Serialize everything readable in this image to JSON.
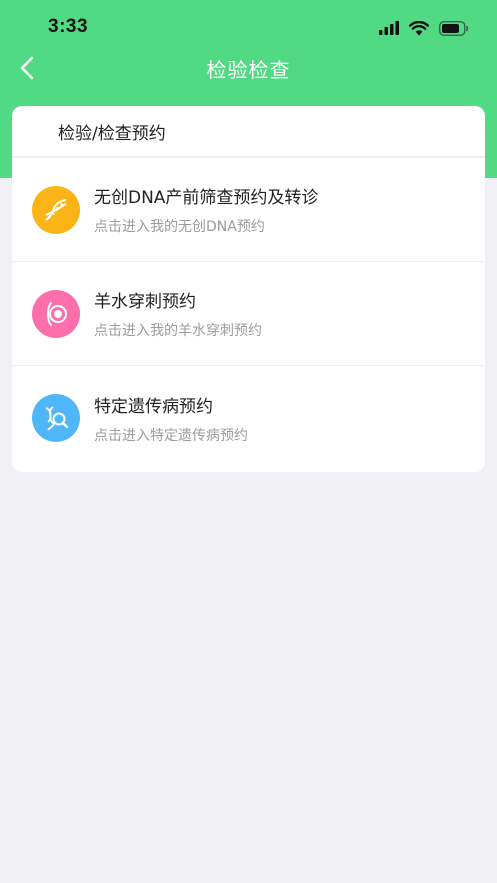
{
  "status_bar": {
    "time": "3:33"
  },
  "nav": {
    "title": "检验检查"
  },
  "card": {
    "heading": "检验/检查预约",
    "items": [
      {
        "title": "无创DNA产前筛查预约及转诊",
        "subtitle": "点击进入我的无创DNA预约",
        "icon": "dna-icon",
        "color": "#fbb416"
      },
      {
        "title": "羊水穿刺预约",
        "subtitle": "点击进入我的羊水穿刺预约",
        "icon": "pregnancy-icon",
        "color": "#fd6eaa"
      },
      {
        "title": "特定遗传病预约",
        "subtitle": "点击进入特定遗传病预约",
        "icon": "gene-search-icon",
        "color": "#4fb6fa"
      }
    ]
  },
  "colors": {
    "header": "#52d983",
    "background": "#f1f1f5"
  }
}
